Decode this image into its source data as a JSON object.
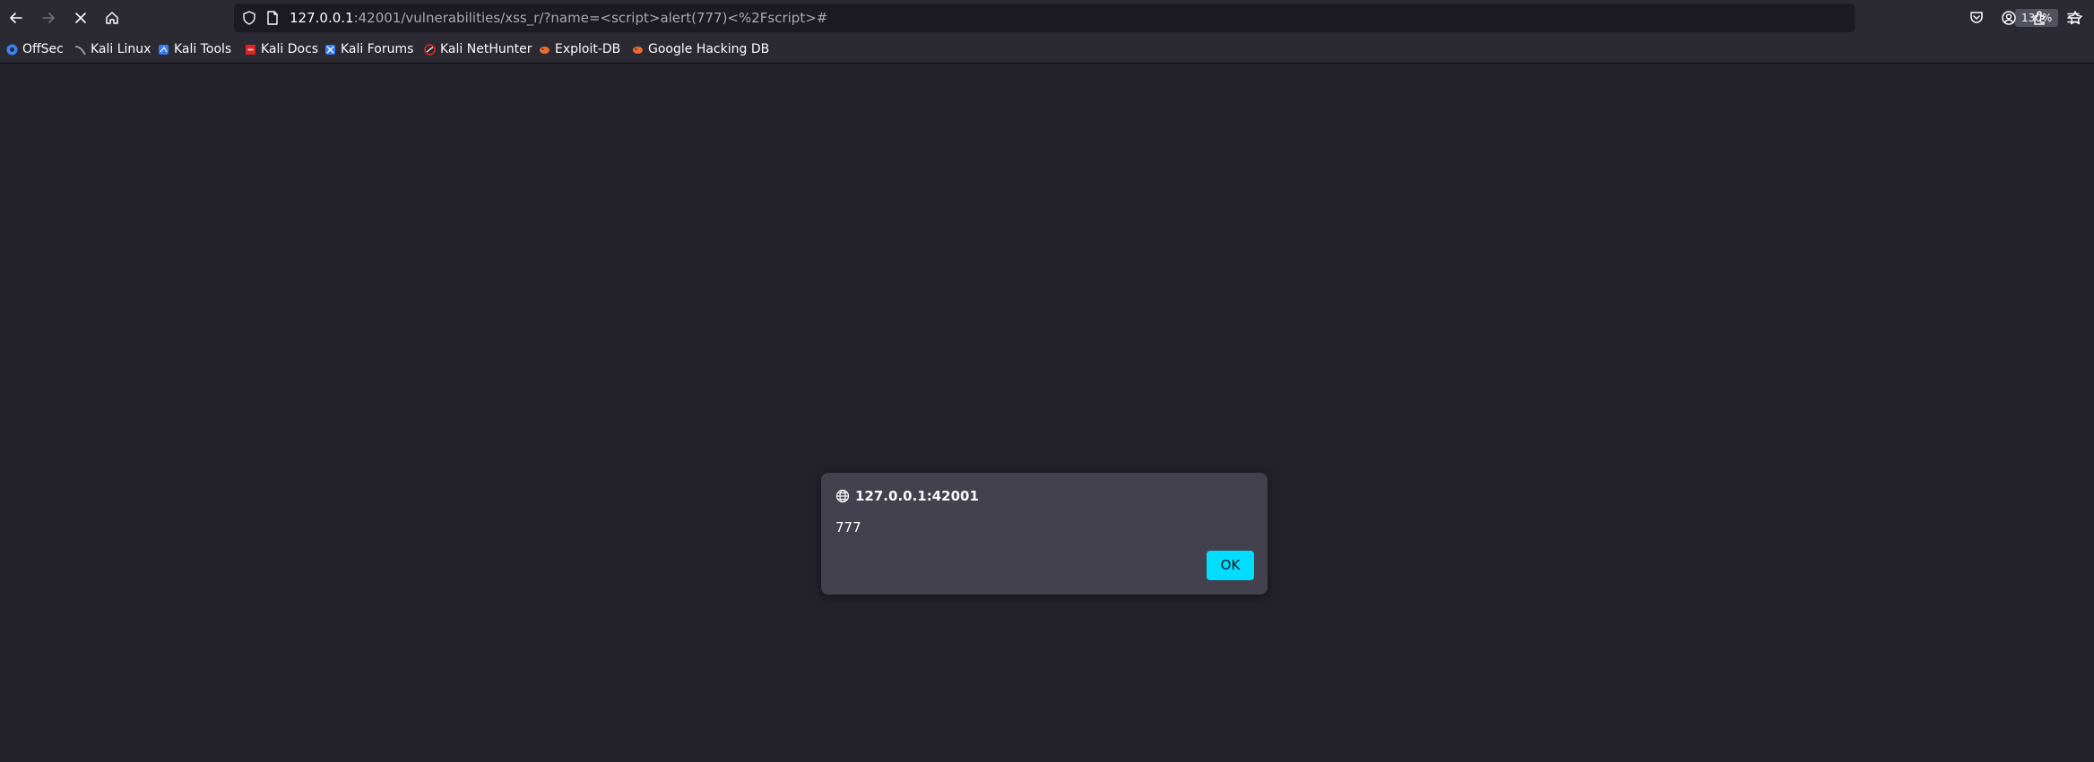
{
  "browser": {
    "url_host": "127.0.0.1",
    "url_rest": ":42001/vulnerabilities/xss_r/?name=<script>alert(777)<%2Fscript>#",
    "zoom": "130%"
  },
  "bookmarks": [
    {
      "label": "OffSec",
      "icon": "offsec-icon"
    },
    {
      "label": "Kali Linux",
      "icon": "kali-icon"
    },
    {
      "label": "Kali Tools",
      "icon": "kali-tools-icon"
    },
    {
      "label": "Kali Docs",
      "icon": "kali-docs-icon"
    },
    {
      "label": "Kali Forums",
      "icon": "kali-forums-icon"
    },
    {
      "label": "Kali NetHunter",
      "icon": "nethunter-icon"
    },
    {
      "label": "Exploit-DB",
      "icon": "exploit-db-icon"
    },
    {
      "label": "Google Hacking DB",
      "icon": "ghdb-icon"
    }
  ],
  "dialog": {
    "origin": "127.0.0.1:42001",
    "message": "777",
    "ok_label": "OK"
  },
  "colors": {
    "page_bg": "#23222b",
    "toolbar_bg": "#2b2a33",
    "dialog_bg": "#42414d",
    "accent": "#00ddff"
  }
}
